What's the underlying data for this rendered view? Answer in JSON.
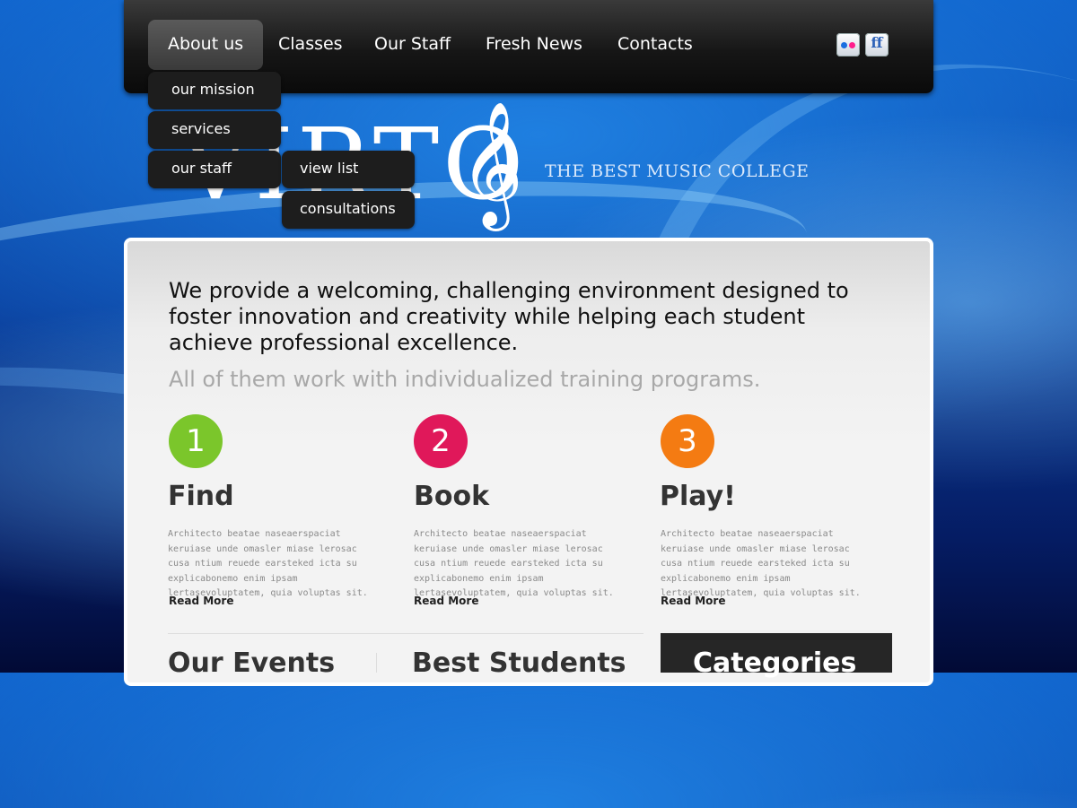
{
  "nav": {
    "items": [
      "About us",
      "Classes",
      "Our Staff",
      "Fresh News",
      "Contacts"
    ],
    "active": "About us",
    "social": [
      "flickr-icon",
      "friendfeed-icon"
    ]
  },
  "dropdown": {
    "level1": [
      "our mission",
      "services",
      "our staff"
    ],
    "level2": [
      "view list",
      "consultations"
    ]
  },
  "logo": {
    "text": "VIRTO",
    "tagline": "THE BEST MUSIC COLLEGE"
  },
  "intro": {
    "headline": "We provide a welcoming, challenging environment designed to foster innovation and creativity while helping each student achieve professional excellence.",
    "subline": "All of them work with individualized training programs."
  },
  "features": [
    {
      "number": "1",
      "title": "Find",
      "color": "#7bc62b",
      "desc": "Architecto beatae naseaerspaciat keruiase unde omasler miase lerosac cusa ntium reuede earsteked icta su explicabonemo enim ipsam lertasevoluptatem, quia voluptas sit.",
      "link": "Read More"
    },
    {
      "number": "2",
      "title": "Book",
      "color": "#e0185a",
      "desc": "Architecto beatae naseaerspaciat keruiase unde omasler miase lerosac cusa ntium reuede earsteked icta su explicabonemo enim ipsam lertasevoluptatem, quia voluptas sit.",
      "link": "Read More"
    },
    {
      "number": "3",
      "title": "Play!",
      "color": "#f47b12",
      "desc": "Architecto beatae naseaerspaciat keruiase unde omasler miase lerosac cusa ntium reuede earsteked icta su explicabonemo enim ipsam lertasevoluptatem, quia voluptas sit.",
      "link": "Read More"
    }
  ],
  "sections": {
    "events": "Our Events",
    "students": "Best Students",
    "categories": "Categories"
  }
}
